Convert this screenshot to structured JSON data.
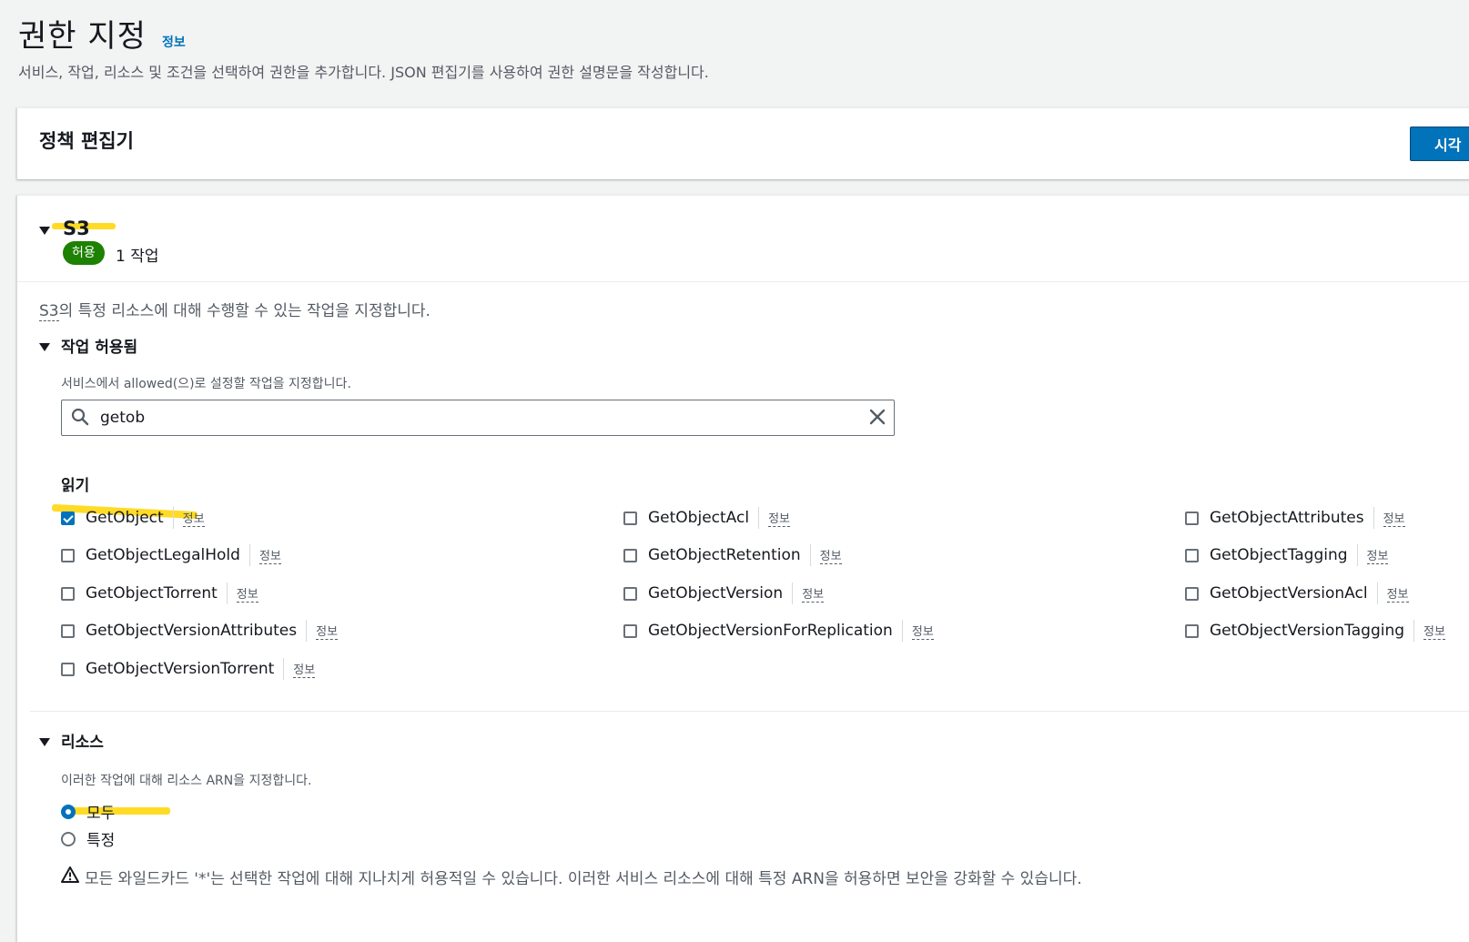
{
  "header": {
    "title": "권한 지정",
    "info_label": "정보",
    "description": "서비스, 작업, 리소스 및 조건을 선택하여 권한을 추가합니다. JSON 편집기를 사용하여 권한 설명문을 작성합니다."
  },
  "editor": {
    "title": "정책 편집기",
    "visual_button_label": "시각"
  },
  "service": {
    "name": "S3",
    "effect_badge": "허용",
    "action_count": "1 작업",
    "description_prefix": "S3",
    "description_suffix": "의 특정 리소스에 대해 수행할 수 있는 작업을 지정합니다."
  },
  "actions_section": {
    "title": "작업 허용됨",
    "description": "서비스에서 allowed(으)로 설정할 작업을 지정합니다.",
    "search_value": "getob",
    "group_title": "읽기",
    "info_label": "정보",
    "actions": [
      {
        "label": "GetObject",
        "checked": true
      },
      {
        "label": "GetObjectAcl",
        "checked": false
      },
      {
        "label": "GetObjectAttributes",
        "checked": false
      },
      {
        "label": "GetObjectLegalHold",
        "checked": false
      },
      {
        "label": "GetObjectRetention",
        "checked": false
      },
      {
        "label": "GetObjectTagging",
        "checked": false
      },
      {
        "label": "GetObjectTorrent",
        "checked": false
      },
      {
        "label": "GetObjectVersion",
        "checked": false
      },
      {
        "label": "GetObjectVersionAcl",
        "checked": false
      },
      {
        "label": "GetObjectVersionAttributes",
        "checked": false
      },
      {
        "label": "GetObjectVersionForReplication",
        "checked": false
      },
      {
        "label": "GetObjectVersionTagging",
        "checked": false
      },
      {
        "label": "GetObjectVersionTorrent",
        "checked": false
      }
    ]
  },
  "resources_section": {
    "title": "리소스",
    "description": "이러한 작업에 대해 리소스 ARN을 지정합니다.",
    "options": [
      {
        "label": "모두",
        "selected": true
      },
      {
        "label": "특정",
        "selected": false
      }
    ],
    "warning": "모든 와일드카드 '*'는 선택한 작업에 대해 지나치게 허용적일 수 있습니다. 이러한 서비스 리소스에 대해 특정 ARN을 허용하면 보안을 강화할 수 있습니다."
  },
  "colors": {
    "accent": "#0073bb",
    "badge_green": "#1d8102",
    "highlight_yellow": "#ffd500",
    "warning_orange": "#ff9900"
  }
}
